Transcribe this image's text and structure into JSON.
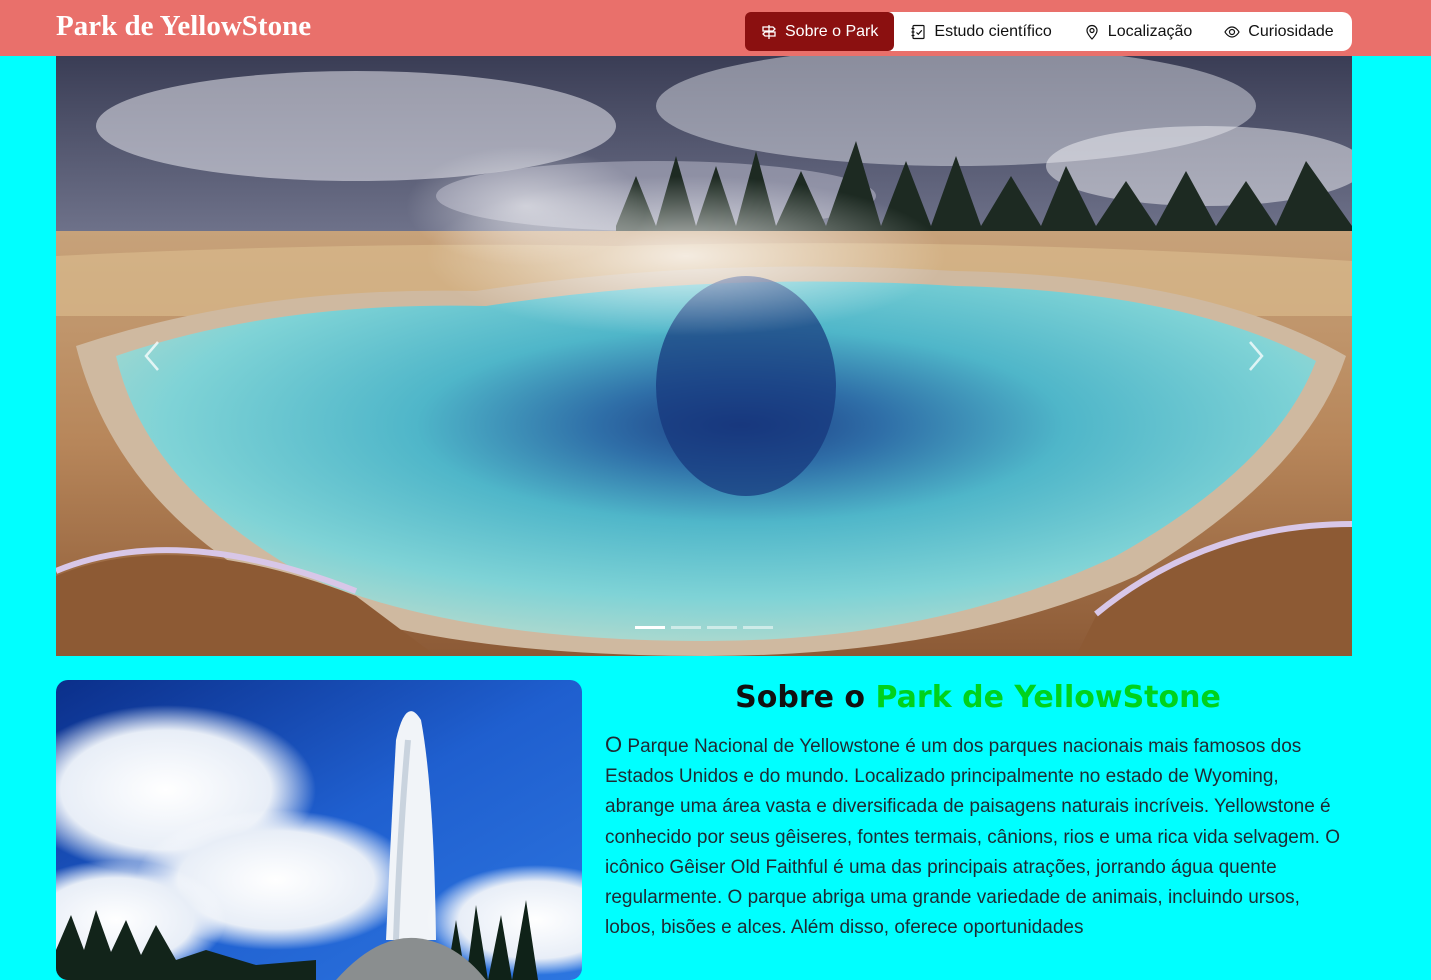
{
  "header": {
    "brand": "Park de YellowStone",
    "nav": [
      {
        "label": "Sobre o Park",
        "icon": "signpost-icon",
        "active": true
      },
      {
        "label": "Estudo científico",
        "icon": "journal-check-icon",
        "active": false
      },
      {
        "label": "Localização",
        "icon": "map-pin-icon",
        "active": false
      },
      {
        "label": "Curiosidade",
        "icon": "eye-icon",
        "active": false
      }
    ]
  },
  "carousel": {
    "image": "hot-spring-pool-photo",
    "slide_count": 4,
    "active_slide": 1,
    "prev_icon": "chevron-left-icon",
    "next_icon": "chevron-right-icon"
  },
  "about": {
    "title_prefix": "Sobre o",
    "title_accent": "Park de YellowStone",
    "image": "geyser-eruption-photo",
    "text_first_letter": "O",
    "text_rest": " Parque Nacional de Yellowstone é um dos parques nacionais mais famosos dos Estados Unidos e do mundo. Localizado principalmente no estado de Wyoming, abrange uma área vasta e diversificada de paisagens naturais incríveis. Yellowstone é conhecido por seus gêiseres, fontes termais, cânions, rios e uma rica vida selvagem. O icônico Gêiser Old Faithful é uma das principais atrações, jorrando água quente regularmente. O parque abriga uma grande variedade de animais, incluindo ursos, lobos, bisões e alces. Além disso, oferece oportunidades"
  },
  "colors": {
    "page_background": "#00ffff",
    "header_background": "#e9706b",
    "active_nav": "#8b1010",
    "title_accent": "#00d21c"
  }
}
